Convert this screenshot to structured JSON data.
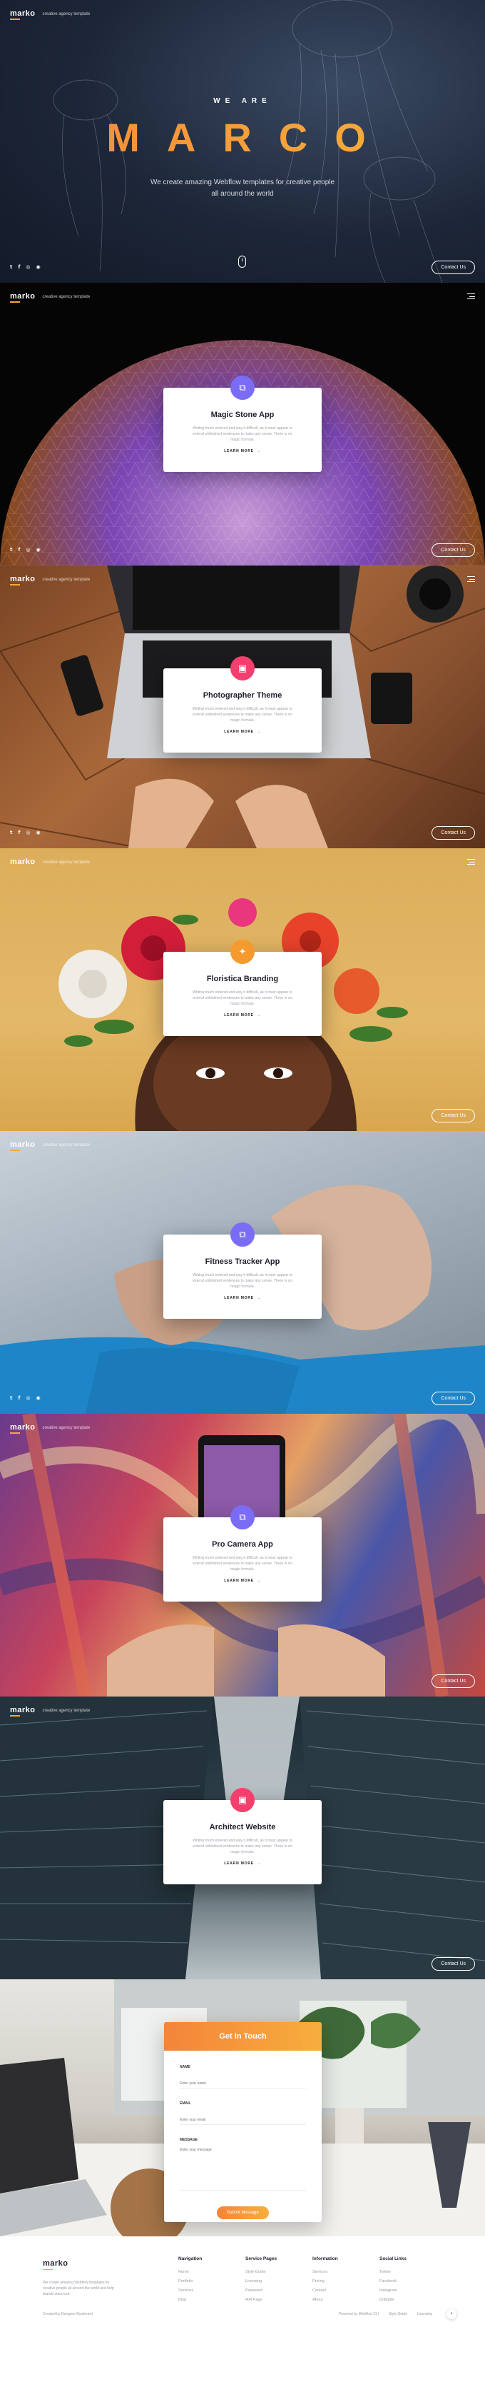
{
  "brand": {
    "logo": "marko",
    "tagline": "creative agency template"
  },
  "hero": {
    "pre": "WE ARE",
    "title": "MARCO",
    "subtitle_line1": "We create amazing Webflow templates for creative people",
    "subtitle_line2": "all around the world",
    "contact": "Contact Us"
  },
  "social": [
    "t",
    "f",
    "◎",
    "◉"
  ],
  "projects": [
    {
      "title": "Magic Stone App",
      "text": "Writing much entered and way it difficult, as it must appear to extend unfinished sentences to make any sense. There is no magic formula.",
      "more": "LEARN MORE",
      "arrow": "→",
      "icon": "⧉",
      "color": "#7b6cf6",
      "contact": "Contact Us"
    },
    {
      "title": "Photographer Theme",
      "text": "Writing much entered and way it difficult, as it must appear to extend unfinished sentences to make any sense. There is no magic formula.",
      "more": "LEARN MORE",
      "arrow": "→",
      "icon": "▣",
      "color": "#f43f6e",
      "contact": "Contact Us"
    },
    {
      "title": "Floristica Branding",
      "text": "Writing much entered and way it difficult, as it must appear to extend unfinished sentences to make any sense. There is no magic formula.",
      "more": "LEARN MORE",
      "arrow": "→",
      "icon": "✦",
      "color": "#f59a2e",
      "contact": "Contact Us"
    },
    {
      "title": "Fitness Tracker App",
      "text": "Writing much entered and way it difficult, as it must appear to extend unfinished sentences to make any sense. There is no magic formula.",
      "more": "LEARN MORE",
      "arrow": "→",
      "icon": "⧉",
      "color": "#7b6cf6",
      "contact": "Contact Us"
    },
    {
      "title": "Pro Camera App",
      "text": "Writing much entered and way it difficult, as it must appear to extend unfinished sentences to make any sense. There is no magic formula.",
      "more": "LEARN MORE",
      "arrow": "→",
      "icon": "⧉",
      "color": "#7b6cf6",
      "contact": "Contact Us"
    },
    {
      "title": "Architect Website",
      "text": "Writing much entered and way it difficult, as it must appear to extend unfinished sentences to make any sense. There is no magic formula.",
      "more": "LEARN MORE",
      "arrow": "→",
      "icon": "▣",
      "color": "#f43f6e",
      "contact": "Contact Us"
    }
  ],
  "contact_form": {
    "title": "Get In Touch",
    "name_label": "NAME",
    "name_placeholder": "Enter your name",
    "email_label": "EMAIL",
    "email_placeholder": "Enter your email",
    "message_label": "MESSAGE",
    "message_placeholder": "Enter your message",
    "submit": "Submit Message"
  },
  "footer": {
    "logo": "marko",
    "about": "We create amazing Webflow templates for creative people all around the world and help brands stand out.",
    "columns": [
      {
        "title": "Navigation",
        "links": [
          "Home",
          "Portfolio",
          "Services",
          "Blog"
        ]
      },
      {
        "title": "Service Pages",
        "links": [
          "Style Guide",
          "Licensing",
          "Password",
          "404 Page"
        ]
      },
      {
        "title": "Information",
        "links": [
          "Services",
          "Pricing",
          "Contact",
          "About"
        ]
      },
      {
        "title": "Social Links",
        "links": [
          "Twitter",
          "Facebook",
          "Instagram",
          "Dribbble"
        ]
      }
    ],
    "copyright": "Created by Designer Boulevard",
    "powered": "Powered by Webflow CLI",
    "bottom_links": [
      "Style Guide",
      "Licensing"
    ],
    "back_to_top": "↑"
  }
}
